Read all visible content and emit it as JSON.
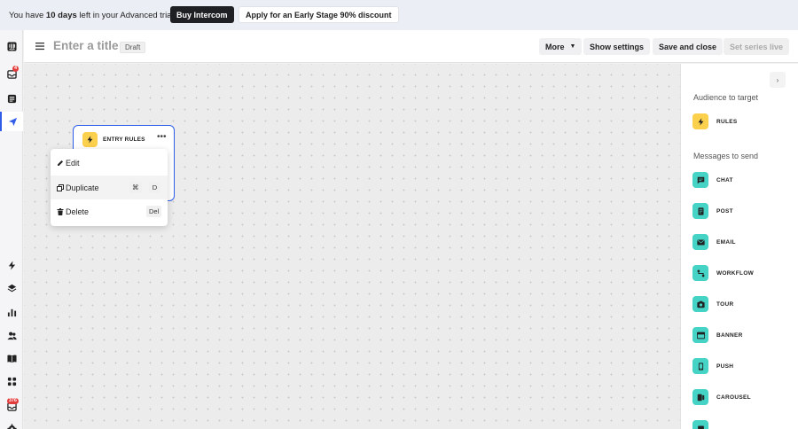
{
  "banner": {
    "text_prefix": "You have ",
    "text_days": "10 days",
    "text_suffix": " left in your Advanced trial",
    "buy_label": "Buy Intercom",
    "discount_label": "Apply for an Early Stage 90% discount"
  },
  "rail": {
    "items": [
      {
        "icon": "intercom-logo-icon"
      },
      {
        "icon": "inbox-icon",
        "badge": "4"
      },
      {
        "icon": "contacts-icon"
      },
      {
        "icon": "outbound-icon",
        "active": true
      },
      {
        "icon": "lightning-icon"
      },
      {
        "icon": "layers-icon"
      },
      {
        "icon": "reports-icon"
      },
      {
        "icon": "people-icon"
      },
      {
        "icon": "book-icon"
      },
      {
        "icon": "apps-icon"
      },
      {
        "icon": "notifications-icon",
        "badge": "376"
      },
      {
        "icon": "settings-icon"
      }
    ]
  },
  "header": {
    "title": "Enter a title",
    "status": "Draft",
    "more_label": "More",
    "show_settings_label": "Show settings",
    "save_close_label": "Save and close",
    "set_live_label": "Set series live"
  },
  "node": {
    "label": "ENTRY RULES"
  },
  "context_menu": {
    "edit_label": "Edit",
    "duplicate_label": "Duplicate",
    "duplicate_shortcut_mod": "⌘",
    "duplicate_shortcut_key": "D",
    "delete_label": "Delete",
    "delete_shortcut": "Del"
  },
  "panel": {
    "audience_heading": "Audience to target",
    "rules_label": "RULES",
    "messages_heading": "Messages to send",
    "messages": [
      {
        "label": "CHAT",
        "icon": "chat-icon"
      },
      {
        "label": "POST",
        "icon": "post-icon"
      },
      {
        "label": "EMAIL",
        "icon": "email-icon"
      },
      {
        "label": "WORKFLOW",
        "icon": "workflow-icon"
      },
      {
        "label": "TOUR",
        "icon": "tour-icon"
      },
      {
        "label": "BANNER",
        "icon": "banner-icon"
      },
      {
        "label": "PUSH",
        "icon": "push-icon"
      },
      {
        "label": "CAROUSEL",
        "icon": "carousel-icon"
      }
    ]
  },
  "colors": {
    "accent": "#2f5de8",
    "rules_yellow": "#fbd04c",
    "message_teal": "#44d3c4"
  }
}
